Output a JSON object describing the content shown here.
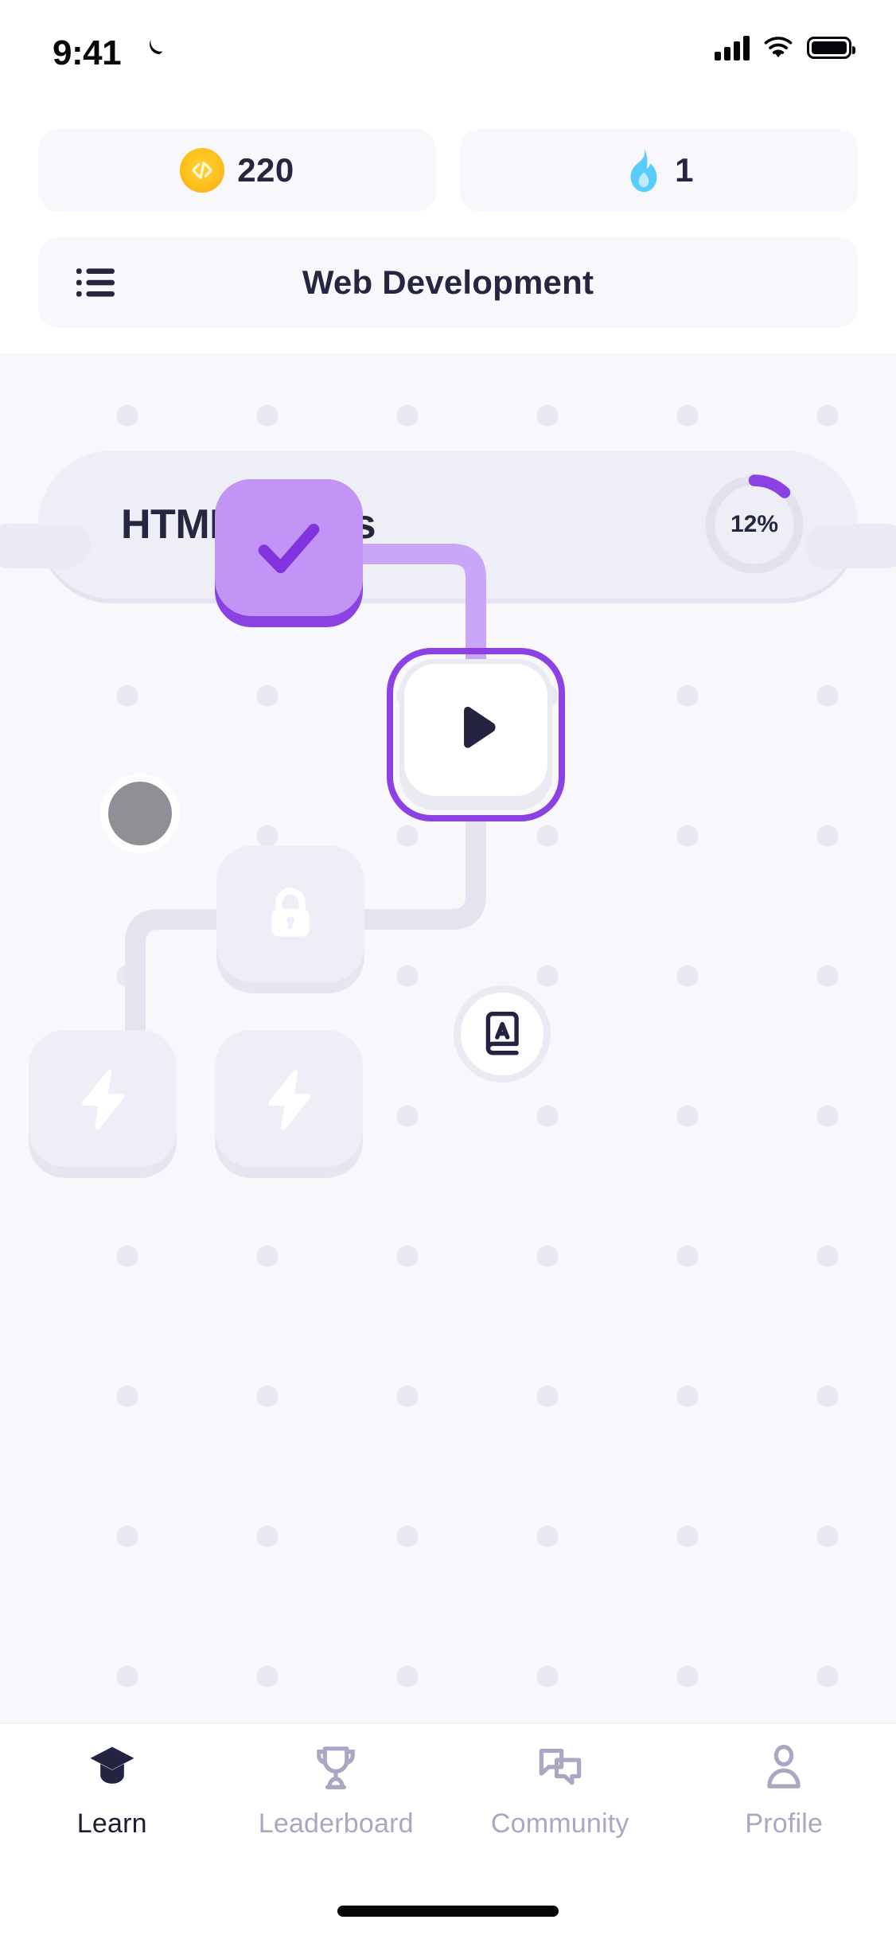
{
  "status_bar": {
    "time": "9:41",
    "moon_icon": "crescent-moon-icon",
    "signal_icon": "cellular-signal-icon",
    "wifi_icon": "wifi-icon",
    "battery_icon": "battery-full-icon"
  },
  "stats": {
    "coins": {
      "icon": "code-coin-icon",
      "value": "220"
    },
    "streak": {
      "icon": "flame-icon",
      "value": "1"
    }
  },
  "course_bar": {
    "menu_icon": "list-menu-icon",
    "title": "Web Development"
  },
  "unit": {
    "title": "HTML Basics",
    "progress_label": "12%",
    "progress_percent": 12,
    "ring_track_color": "#e2e2ee",
    "ring_fill_color": "#8c41e3"
  },
  "path": {
    "nodes": [
      {
        "id": "node-1",
        "state": "completed",
        "icon": "check-icon",
        "color": "#8c41e3"
      },
      {
        "id": "node-2",
        "state": "current",
        "icon": "play-icon",
        "color": "#8c41e3"
      },
      {
        "id": "node-3",
        "state": "locked",
        "icon": "lock-icon",
        "color": "#e6e6f1"
      },
      {
        "id": "node-4",
        "state": "locked",
        "icon": "lightning-bolt-icon",
        "color": "#e6e6f1"
      },
      {
        "id": "node-5",
        "state": "locked",
        "icon": "lightning-bolt-icon",
        "color": "#e6e6f1"
      }
    ],
    "user_marker": {
      "icon": "user-position-dot",
      "color": "#8f8f96"
    },
    "glossary_button": {
      "icon": "book-a-icon"
    }
  },
  "bottom_nav": {
    "items": [
      {
        "label": "Learn",
        "icon": "graduation-cap-icon",
        "active": true
      },
      {
        "label": "Leaderboard",
        "icon": "trophy-icon",
        "active": false
      },
      {
        "label": "Community",
        "icon": "chat-bubbles-icon",
        "active": false
      },
      {
        "label": "Profile",
        "icon": "person-icon",
        "active": false
      }
    ]
  }
}
